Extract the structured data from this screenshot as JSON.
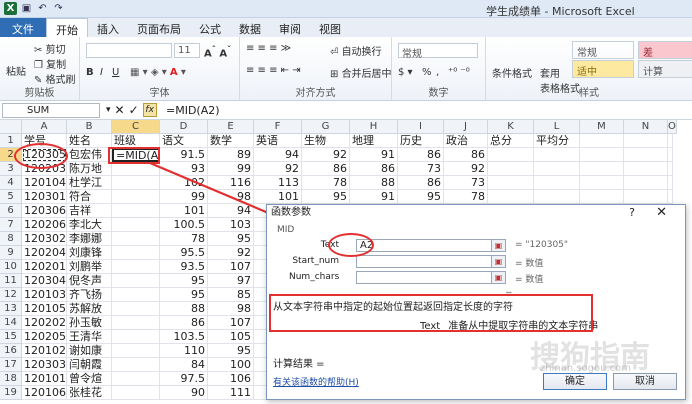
{
  "window": {
    "title": "学生成绩单 - Microsoft Excel"
  },
  "tabs": [
    "文件",
    "开始",
    "插入",
    "页面布局",
    "公式",
    "数据",
    "审阅",
    "视图"
  ],
  "ribbon": {
    "clipboard": {
      "paste": "粘贴",
      "cut": "剪切",
      "copy": "复制",
      "format_painter": "格式刷",
      "label": "剪贴板"
    },
    "font": {
      "size": "11",
      "bold": "B",
      "italic": "I",
      "underline": "U",
      "label": "字体"
    },
    "alignment": {
      "wrap": "自动换行",
      "merge": "合并后居中",
      "label": "对齐方式"
    },
    "number": {
      "format": "常规",
      "percent": "%",
      "comma": ",",
      "label": "数字"
    },
    "styles": {
      "conditional": "条件格式",
      "table": "套用",
      "table2": "表格格式",
      "normal": "常规",
      "bad": "差",
      "good": "适中",
      "calc": "计算",
      "label": "样式"
    }
  },
  "formula_bar": {
    "name_box": "SUM",
    "cancel": "✕",
    "enter": "✓",
    "fx": "fx",
    "formula": "=MID(A2)"
  },
  "columns": [
    "A",
    "B",
    "C",
    "D",
    "E",
    "F",
    "G",
    "H",
    "I",
    "J",
    "K",
    "L",
    "M",
    "N",
    "O"
  ],
  "rows": [
    [
      "学号",
      "姓名",
      "班级",
      "语文",
      "数学",
      "英语",
      "生物",
      "地理",
      "历史",
      "政治",
      "总分",
      "平均分"
    ],
    [
      "120305",
      "包宏伟",
      "=MID(A2)",
      "91.5",
      "89",
      "94",
      "92",
      "91",
      "86",
      "86",
      "",
      ""
    ],
    [
      "120203",
      "陈万地",
      "",
      "93",
      "99",
      "92",
      "86",
      "86",
      "73",
      "92",
      "",
      ""
    ],
    [
      "120104",
      "杜学江",
      "",
      "102",
      "116",
      "113",
      "78",
      "88",
      "86",
      "73",
      "",
      ""
    ],
    [
      "120301",
      "符合",
      "",
      "99",
      "98",
      "101",
      "95",
      "91",
      "95",
      "78",
      "",
      ""
    ],
    [
      "120306",
      "吉祥",
      "",
      "101",
      "94",
      "",
      "",
      "",
      "",
      "",
      "",
      ""
    ],
    [
      "120206",
      "李北大",
      "",
      "100.5",
      "103",
      "",
      "",
      "",
      "",
      "",
      "",
      ""
    ],
    [
      "120302",
      "李娜娜",
      "",
      "78",
      "95",
      "",
      "",
      "",
      "",
      "",
      "",
      ""
    ],
    [
      "120204",
      "刘康锋",
      "",
      "95.5",
      "92",
      "",
      "",
      "",
      "",
      "",
      "",
      ""
    ],
    [
      "120201",
      "刘鹏举",
      "",
      "93.5",
      "107",
      "",
      "",
      "",
      "",
      "",
      "",
      ""
    ],
    [
      "120304",
      "倪冬声",
      "",
      "95",
      "97",
      "",
      "",
      "",
      "",
      "",
      "",
      ""
    ],
    [
      "120103",
      "齐飞扬",
      "",
      "95",
      "85",
      "",
      "",
      "",
      "",
      "",
      "",
      ""
    ],
    [
      "120105",
      "苏解放",
      "",
      "88",
      "98",
      "",
      "",
      "",
      "",
      "",
      "",
      ""
    ],
    [
      "120202",
      "孙玉敏",
      "",
      "86",
      "107",
      "",
      "",
      "",
      "",
      "",
      "",
      ""
    ],
    [
      "120205",
      "王清华",
      "",
      "103.5",
      "105",
      "",
      "",
      "",
      "",
      "",
      "",
      ""
    ],
    [
      "120102",
      "谢如康",
      "",
      "110",
      "95",
      "",
      "",
      "",
      "",
      "",
      "",
      ""
    ],
    [
      "120303",
      "闫朝霞",
      "",
      "84",
      "100",
      "",
      "",
      "",
      "",
      "",
      "",
      ""
    ],
    [
      "120101",
      "曾令煊",
      "",
      "97.5",
      "106",
      "",
      "",
      "",
      "",
      "",
      "",
      ""
    ],
    [
      "120106",
      "张桂花",
      "",
      "90",
      "111",
      "",
      "",
      "",
      "",
      "",
      "",
      ""
    ]
  ],
  "dialog": {
    "title": "函数参数",
    "help_q": "?",
    "close": "✕",
    "function_name": "MID",
    "args": [
      {
        "label": "Text",
        "value": "A2",
        "result": "= \"120305\""
      },
      {
        "label": "Start_num",
        "value": "",
        "result": "= 数值"
      },
      {
        "label": "Num_chars",
        "value": "",
        "result": "= 数值"
      }
    ],
    "equals": "=",
    "description": "从文本字符串中指定的起始位置起返回指定长度的字符",
    "arg_name": "Text",
    "arg_desc": "准备从中提取字符串的文本字符串",
    "calc_result": "计算结果 =",
    "help_link": "有关该函数的帮助(H)",
    "ok": "确定",
    "cancel": "取消"
  },
  "watermark": {
    "text": "搜狗指南",
    "url": "zhinan.sogou.com"
  }
}
